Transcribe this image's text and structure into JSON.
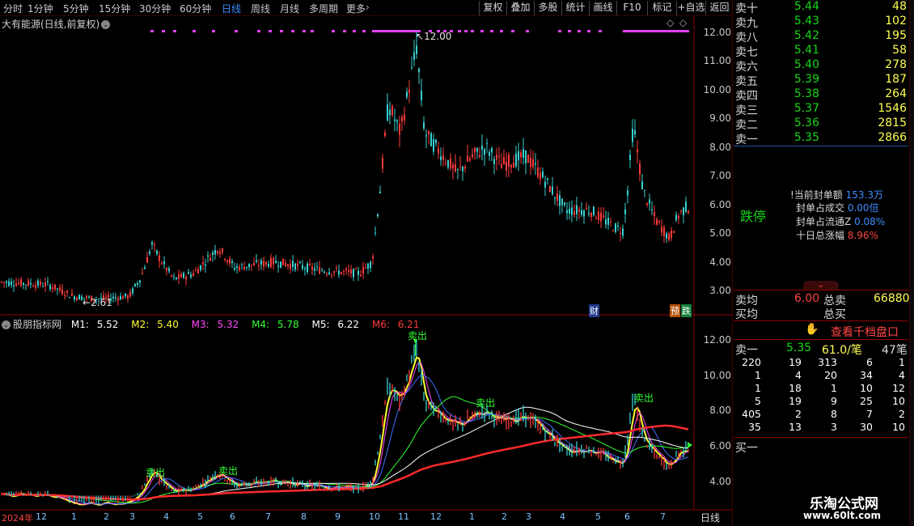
{
  "toolbar": {
    "periods": [
      "分时",
      "1分钟",
      "5分钟",
      "15分钟",
      "30分钟",
      "60分钟",
      "日线",
      "周线",
      "月线",
      "多周期",
      "更多"
    ],
    "active_period": "日线",
    "tools": [
      "复权",
      "叠加",
      "多股",
      "统计",
      "画线",
      "F10",
      "标记",
      "+自选",
      "返回"
    ]
  },
  "main_chart": {
    "title": "大有能源(日线,前复权)",
    "high_label": "12.00",
    "low_label": "2.61",
    "y_ticks": [
      "12.00",
      "11.00",
      "10.00",
      "9.00",
      "8.00",
      "7.00",
      "6.00",
      "5.00",
      "4.00",
      "3.00"
    ],
    "badges": {
      "cai": "财",
      "yu": "预",
      "die": "跌"
    },
    "candle_up_color": "#ff3b3b",
    "candle_down_color": "#37d1d1"
  },
  "indicator": {
    "name": "股朋指标网",
    "mas": [
      {
        "label": "M1:",
        "value": "5.52",
        "color": "#ffffff"
      },
      {
        "label": "M2:",
        "value": "5.40",
        "color": "#ffff33"
      },
      {
        "label": "M3:",
        "value": "5.32",
        "color": "#ff44ff"
      },
      {
        "label": "M4:",
        "value": "5.78",
        "color": "#33ff33"
      },
      {
        "label": "M5:",
        "value": "6.22",
        "color": "#ffffff"
      },
      {
        "label": "M6:",
        "value": "6.21",
        "color": "#ff3b3b"
      }
    ],
    "y_ticks": [
      "12.00",
      "10.00",
      "8.00",
      "6.00",
      "4.00"
    ],
    "sell_label": "卖出"
  },
  "date_axis": {
    "year_label": "2024年",
    "labels": [
      "12",
      "1",
      "2",
      "3",
      "4",
      "5",
      "6",
      "7",
      "8",
      "9",
      "10",
      "11",
      "12",
      "1",
      "2",
      "3",
      "4",
      "5",
      "6",
      "7"
    ],
    "period_label": "日线"
  },
  "order_book": {
    "asks": [
      {
        "label": "卖十",
        "price": "5.44",
        "vol": "48"
      },
      {
        "label": "卖九",
        "price": "5.43",
        "vol": "102"
      },
      {
        "label": "卖八",
        "price": "5.42",
        "vol": "195"
      },
      {
        "label": "卖七",
        "price": "5.41",
        "vol": "58"
      },
      {
        "label": "卖六",
        "price": "5.40",
        "vol": "278"
      },
      {
        "label": "卖五",
        "price": "5.39",
        "vol": "187"
      },
      {
        "label": "卖四",
        "price": "5.38",
        "vol": "264"
      },
      {
        "label": "卖三",
        "price": "5.37",
        "vol": "1546"
      },
      {
        "label": "卖二",
        "price": "5.36",
        "vol": "2815"
      },
      {
        "label": "卖一",
        "price": "5.35",
        "vol": "2866"
      }
    ]
  },
  "seal_info": {
    "status": "跌停",
    "rows": [
      {
        "label": "!当前封单额",
        "value": "153.3万",
        "color": "blue"
      },
      {
        "label": "封单占成交",
        "value": "0.00倍",
        "color": "blue"
      },
      {
        "label": "封单占流通Z",
        "value": "0.08%",
        "color": "blue"
      },
      {
        "label": "十日总涨幅",
        "value": "8.96%",
        "color": "red"
      }
    ]
  },
  "summary": {
    "sell_avg_label": "卖均",
    "sell_avg_value": "6.00",
    "total_sell_label": "总卖",
    "total_sell_value": "66880",
    "buy_avg_label": "买均",
    "total_buy_label": "总买",
    "thousand_label": "查看千档盘口",
    "sell1_label": "卖一",
    "sell1_price": "5.35",
    "sell1_per": "61.0/笔",
    "sell1_count": "47笔",
    "buy1_label": "买一"
  },
  "order_grid": [
    [
      "220",
      "19",
      "313",
      "6",
      "1"
    ],
    [
      "1",
      "4",
      "20",
      "34",
      "4"
    ],
    [
      "1",
      "18",
      "1",
      "10",
      "12"
    ],
    [
      "5",
      "19",
      "9",
      "25",
      "10"
    ],
    [
      "405",
      "2",
      "8",
      "7",
      "2"
    ],
    [
      "35",
      "13",
      "3",
      "30",
      "10"
    ]
  ],
  "watermark": {
    "line1": "乐淘公式网",
    "line2": "www.60lt.com"
  }
}
